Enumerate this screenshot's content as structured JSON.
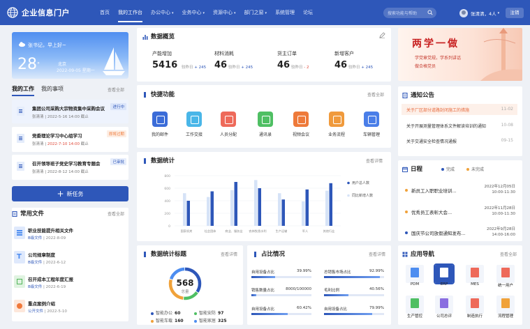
{
  "header": {
    "app_title": "企业信息门户",
    "nav": [
      "首页",
      "我的工作台",
      "办公中心",
      "业务中心",
      "资源中心",
      "部门之窗",
      "系统管理",
      "论坛"
    ],
    "active_nav": "我的工作台",
    "search_placeholder": "搜索功能与帮助",
    "user_name": "张清清，4人",
    "logout": "注销"
  },
  "weather": {
    "greeting": "张书记，早上好~",
    "temp": "28",
    "unit": "°",
    "city": "北京",
    "date": "2022-09-05  星期一"
  },
  "work": {
    "tabs": [
      "我的工作",
      "我的事项"
    ],
    "more": "查看全部",
    "items": [
      {
        "title": "集团公司采购大宗物资集中采购会议",
        "meta_name": "张清清",
        "meta_date": "2022-5-16 14:00",
        "meta_tag": "截止",
        "status": "进行中",
        "status_color": "#2e57b9",
        "status_bg": "#e6edfb"
      },
      {
        "title": "党委理论学习中心组学习",
        "meta_name": "张清清",
        "meta_date": "2022-7-10 14:00",
        "meta_tag": "截止",
        "status": "即将过期",
        "status_color": "#ee7a3a",
        "status_bg": "#fdeee4"
      },
      {
        "title": "召开领导班子党史学习教育专题会",
        "meta_name": "张清清",
        "meta_date": "2022-8-12 14:00",
        "meta_tag": "截止",
        "status": "已审批",
        "status_color": "#2e57b9",
        "status_bg": "#e6edfb"
      }
    ],
    "new_task": "新任务"
  },
  "files": {
    "title": "常用文件",
    "more": "查看全部",
    "items": [
      {
        "name": "职业技能提升相关文件",
        "type": "B级文件",
        "date": "2022-8-09",
        "color": "#4d8df0"
      },
      {
        "name": "公司规章制度",
        "type": "B级文件",
        "date": "2022-6-12",
        "color": "#4d8df0"
      },
      {
        "name": "召开成本工程年度汇报",
        "type": "B级文件",
        "date": "2022-6-19",
        "color": "#52b55a"
      },
      {
        "name": "重点案例介绍",
        "type": "公开文件",
        "date": "2022-5-10",
        "color": "#f0793a"
      }
    ]
  },
  "overview": {
    "title": "数据概览",
    "kpis": [
      {
        "label": "产能增加",
        "value": "5416",
        "cmp": "较昨日",
        "delta": "+ 245",
        "dir": "up"
      },
      {
        "label": "材料消耗",
        "value": "46",
        "cmp": "较昨日",
        "delta": "+ 245",
        "dir": "up"
      },
      {
        "label": "货主订单",
        "value": "46",
        "cmp": "较昨日",
        "delta": "- 2",
        "dir": "down"
      },
      {
        "label": "新增客户",
        "value": "46",
        "cmp": "较昨日",
        "delta": "+ 245",
        "dir": "up"
      }
    ]
  },
  "quick": {
    "title": "快捷功能",
    "more": "查看全部",
    "items": [
      {
        "label": "我的邮件",
        "color": "#3b6cd8"
      },
      {
        "label": "工作交接",
        "color": "#49b6e8"
      },
      {
        "label": "人员分配",
        "color": "#ee6a5a"
      },
      {
        "label": "通讯录",
        "color": "#4fbf63"
      },
      {
        "label": "视频会议",
        "color": "#ee7a3a"
      },
      {
        "label": "业务流程",
        "color": "#f09a3c"
      },
      {
        "label": "车辆管理",
        "color": "#4a7ee8"
      }
    ]
  },
  "stats": {
    "title": "数据统计",
    "more": "查看详情"
  },
  "chart_data": {
    "type": "bar",
    "categories": [
      "国家机关",
      "社会团体",
      "商业、服务业",
      "农林牧渔水利",
      "生产运输",
      "军人",
      "其他行业"
    ],
    "series": [
      {
        "name": "用户总人数",
        "color": "#2e57b9",
        "values": [
          400,
          550,
          700,
          600,
          420,
          580,
          680
        ]
      },
      {
        "name": "同比新增人数",
        "color": "#d6e3f7",
        "values": [
          520,
          460,
          570,
          730,
          520,
          390,
          560
        ]
      }
    ],
    "ylim": [
      0,
      800
    ],
    "yticks": [
      0,
      200,
      400,
      600,
      800
    ],
    "legend": "right"
  },
  "gauge": {
    "title": "数据统计标题",
    "more": "查看详情",
    "total": "568",
    "total_label": "总量",
    "items": [
      {
        "label": "智能办公",
        "value": "60",
        "color": "#2e57b9"
      },
      {
        "label": "智能安防",
        "value": "97",
        "color": "#4fbf63"
      },
      {
        "label": "智能车载",
        "value": "160",
        "color": "#f0a23a"
      },
      {
        "label": "智能家居",
        "value": "325",
        "color": "#4d8df0"
      }
    ],
    "segments": [
      0.35,
      0.17,
      0.28,
      0.2
    ]
  },
  "ratio": {
    "title": "占比情况",
    "more": "查看详情",
    "items": [
      {
        "label": "自用设备占比",
        "value": "39.99%",
        "fill": 0.4
      },
      {
        "label": "总销售市场占比",
        "value": "92.99%",
        "fill": 0.93
      },
      {
        "label": "销售数量占比",
        "value": "8000/100000",
        "fill": 0.08
      },
      {
        "label": "毛利比例",
        "value": "40.56%",
        "fill": 0.41
      },
      {
        "label": "自用设备占比",
        "value": "60.42%",
        "fill": 0.6
      },
      {
        "label": "自用设备占比",
        "value": "79.99%",
        "fill": 0.8
      }
    ]
  },
  "banner": {
    "title": "两学一做",
    "sub1": "学党章党规，学系列讲话",
    "sub2": "做合格党员"
  },
  "notices": {
    "title": "通知公告",
    "items": [
      {
        "text": "关于厂区部分道路封闭施工的措施",
        "date": "11-02",
        "highlight": true
      },
      {
        "text": "关于开展测量管理体系文件解读培训的通知",
        "date": "10-08",
        "highlight": false
      },
      {
        "text": "关于交通安全检查情况通报",
        "date": "09-15",
        "highlight": false
      }
    ]
  },
  "schedule": {
    "title": "日程",
    "done_label": "完成",
    "undone_label": "未完成",
    "items": [
      {
        "text": "新员工入职职业培训...",
        "date": "2022年12月05日",
        "time": "10:00-11:30",
        "color": "#f0a23a"
      },
      {
        "text": "优秀员工表彰大会...",
        "date": "2022年11月28日",
        "time": "10:00-11:30",
        "color": "#f0a23a"
      },
      {
        "text": "国庆节公司放假通知发布...",
        "date": "2022年9月28日",
        "time": "14:00-16:00",
        "color": "#2e57b9"
      }
    ]
  },
  "apps": {
    "title": "应用导航",
    "more": "查看全部",
    "items": [
      {
        "label": "PDM",
        "color": "#4d8df0",
        "active": false
      },
      {
        "label": "ERP",
        "color": "#ffffff",
        "active": true
      },
      {
        "label": "MES",
        "color": "#ee6a5a",
        "active": false
      },
      {
        "label": "统一用户",
        "color": "#ee6a5a",
        "active": false
      },
      {
        "label": "生产管控",
        "color": "#4fbf63",
        "active": false
      },
      {
        "label": "公司总评",
        "color": "#8a6ee0",
        "active": false
      },
      {
        "label": "制造执行",
        "color": "#ee6a5a",
        "active": false
      },
      {
        "label": "流程管理",
        "color": "#f0a23a",
        "active": false
      }
    ]
  }
}
